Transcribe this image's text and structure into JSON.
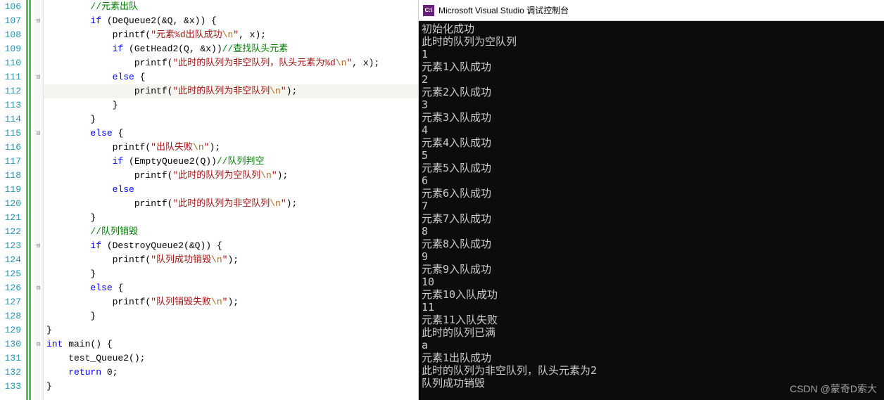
{
  "editor": {
    "lines": [
      {
        "n": "106",
        "fold": "",
        "html": "        <span class='cm'>//元素出队</span>"
      },
      {
        "n": "107",
        "fold": "box",
        "html": "        <span class='kw'>if</span> (DeQueue2(&Q, &x)) {"
      },
      {
        "n": "108",
        "fold": "",
        "html": "            printf(<span class='str'>\"元素%d出队成功<span class='esc'>\\n</span>\"</span>, x);"
      },
      {
        "n": "109",
        "fold": "",
        "html": "            <span class='kw'>if</span> (GetHead2(Q, &x))<span class='cm'>//查找队头元素</span>"
      },
      {
        "n": "110",
        "fold": "",
        "html": "                printf(<span class='str'>\"此时的队列为非空队列，队头元素为%d<span class='esc'>\\n</span>\"</span>, x);"
      },
      {
        "n": "111",
        "fold": "box",
        "html": "            <span class='kw'>else</span> {",
        "hl": false
      },
      {
        "n": "112",
        "fold": "",
        "html": "                printf(<span class='str'>\"此时的队列为非空队列<span class='esc'>\\n</span>\"</span>);",
        "hl": true
      },
      {
        "n": "113",
        "fold": "",
        "html": "            }"
      },
      {
        "n": "114",
        "fold": "",
        "html": "        }"
      },
      {
        "n": "115",
        "fold": "box",
        "html": "        <span class='kw'>else</span> {"
      },
      {
        "n": "116",
        "fold": "",
        "html": "            printf(<span class='str'>\"出队失败<span class='esc'>\\n</span>\"</span>);"
      },
      {
        "n": "117",
        "fold": "",
        "html": "            <span class='kw'>if</span> (EmptyQueue2(Q))<span class='cm'>//队列判空</span>"
      },
      {
        "n": "118",
        "fold": "",
        "html": "                printf(<span class='str'>\"此时的队列为空队列<span class='esc'>\\n</span>\"</span>);"
      },
      {
        "n": "119",
        "fold": "",
        "html": "            <span class='kw'>else</span>"
      },
      {
        "n": "120",
        "fold": "",
        "html": "                printf(<span class='str'>\"此时的队列为非空队列<span class='esc'>\\n</span>\"</span>);"
      },
      {
        "n": "121",
        "fold": "",
        "html": "        }"
      },
      {
        "n": "122",
        "fold": "",
        "html": "        <span class='cm'>//队列销毁</span>"
      },
      {
        "n": "123",
        "fold": "box",
        "html": "        <span class='kw'>if</span> (DestroyQueue2(&Q)) {"
      },
      {
        "n": "124",
        "fold": "",
        "html": "            printf(<span class='str'>\"队列成功销毁<span class='esc'>\\n</span>\"</span>);"
      },
      {
        "n": "125",
        "fold": "",
        "html": "        }"
      },
      {
        "n": "126",
        "fold": "box",
        "html": "        <span class='kw'>else</span> {"
      },
      {
        "n": "127",
        "fold": "",
        "html": "            printf(<span class='str'>\"队列销毁失败<span class='esc'>\\n</span>\"</span>);"
      },
      {
        "n": "128",
        "fold": "",
        "html": "        }"
      },
      {
        "n": "129",
        "fold": "",
        "html": "}"
      },
      {
        "n": "130",
        "fold": "box",
        "html": "<span class='kw'>int</span> main() {"
      },
      {
        "n": "131",
        "fold": "",
        "html": "    test_Queue2();"
      },
      {
        "n": "132",
        "fold": "",
        "html": "    <span class='kw'>return</span> 0;"
      },
      {
        "n": "133",
        "fold": "",
        "html": "}"
      }
    ]
  },
  "console": {
    "icon_text": "C:\\",
    "title": "Microsoft Visual Studio 调试控制台",
    "output": [
      "初始化成功",
      "此时的队列为空队列",
      "1",
      "元素1入队成功",
      "2",
      "元素2入队成功",
      "3",
      "元素3入队成功",
      "4",
      "元素4入队成功",
      "5",
      "元素5入队成功",
      "6",
      "元素6入队成功",
      "7",
      "元素7入队成功",
      "8",
      "元素8入队成功",
      "9",
      "元素9入队成功",
      "10",
      "元素10入队成功",
      "11",
      "元素11入队失败",
      "此时的队列已满",
      "a",
      "元素1出队成功",
      "此时的队列为非空队列，队头元素为2",
      "队列成功销毁"
    ]
  },
  "watermark": "CSDN @蒙奇D索大"
}
